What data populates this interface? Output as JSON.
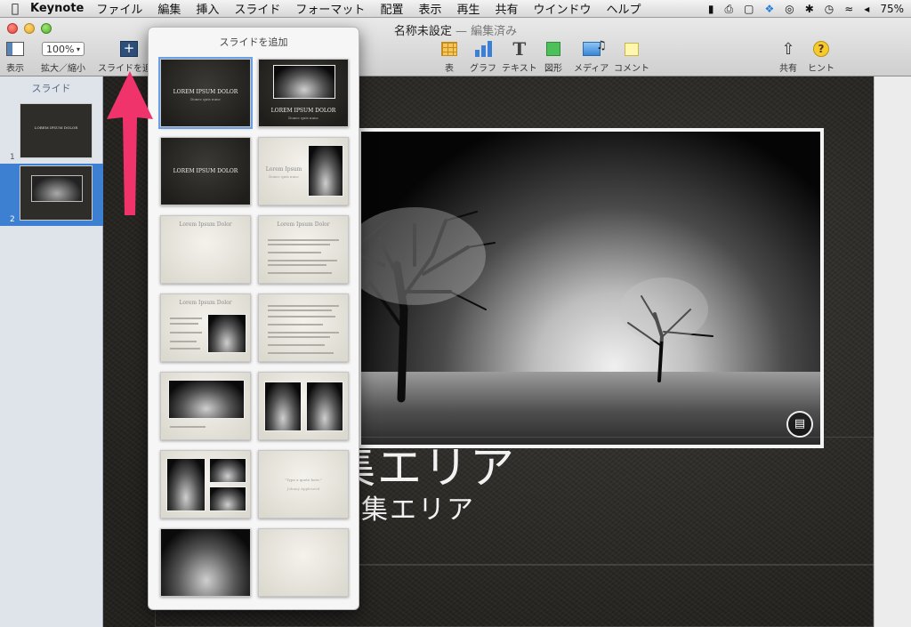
{
  "menubar": {
    "app_name": "Keynote",
    "items": [
      "ファイル",
      "編集",
      "挿入",
      "スライド",
      "フォーマット",
      "配置",
      "表示",
      "再生",
      "共有",
      "ウインドウ",
      "ヘルプ"
    ],
    "battery": "75%"
  },
  "window": {
    "title": "名称未設定",
    "title_suffix": " — 編集済み"
  },
  "toolbar": {
    "view_label": "表示",
    "zoom_value": "100%",
    "zoom_label": "拡大／縮小",
    "add_slide_label": "スライドを追加",
    "table_label": "表",
    "chart_label": "グラフ",
    "text_label": "テキスト",
    "shape_label": "図形",
    "media_label": "メディア",
    "comment_label": "コメント",
    "share_label": "共有",
    "hint_label": "ヒント"
  },
  "navigator": {
    "header": "スライド",
    "slides": [
      {
        "number": "1",
        "text": "LOREM IPSUM DOLOR"
      },
      {
        "number": "2"
      }
    ]
  },
  "popover": {
    "title": "スライドを追加",
    "layouts": [
      {
        "title": "LOREM IPSUM DOLOR",
        "subtitle": "Donec quis nunc"
      },
      {
        "title": "LOREM IPSUM DOLOR",
        "subtitle": "Donec quis nunc"
      },
      {
        "title": "LOREM IPSUM DOLOR"
      },
      {
        "title": "Lorem Ipsum",
        "subtitle": "Donec quis nunc"
      },
      {
        "title": "Lorem Ipsum Dolor"
      },
      {
        "title": "Lorem Ipsum Dolor"
      },
      {
        "title": "Lorem Ipsum Dolor"
      },
      {
        "quote": "\"Type a quote here.\"",
        "attribution": "Johnny Appleseed"
      }
    ]
  },
  "canvas": {
    "title": "編集エリア",
    "subtitle": "編集エリア"
  },
  "colors": {
    "selection": "#3d7fd1",
    "annotation_arrow": "#f0336b"
  }
}
